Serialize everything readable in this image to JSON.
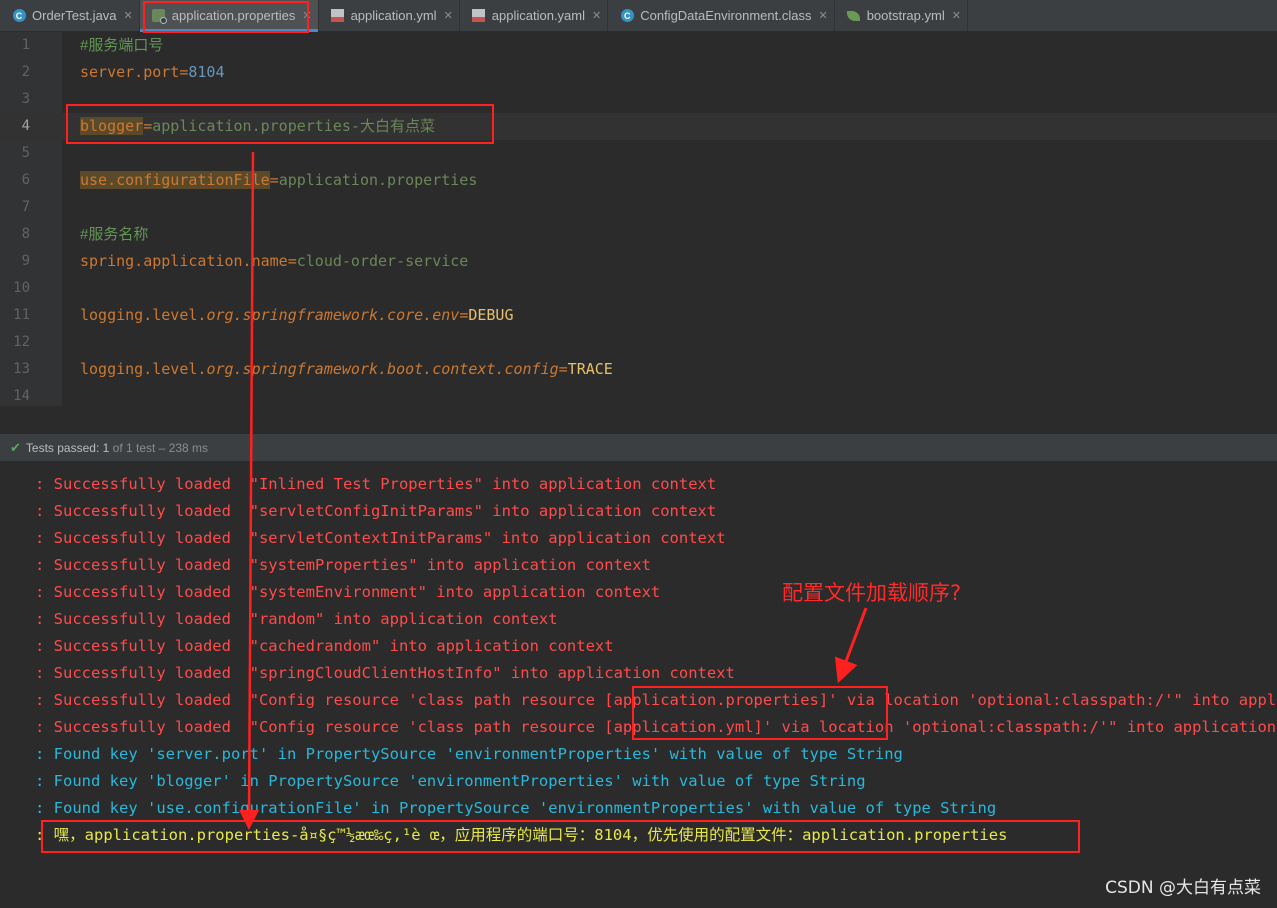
{
  "tabs": [
    {
      "label": "OrderTest.java",
      "icon": "java-class-icon"
    },
    {
      "label": "application.properties",
      "icon": "properties-file-icon",
      "active": true
    },
    {
      "label": "application.yml",
      "icon": "yml-file-icon"
    },
    {
      "label": "application.yaml",
      "icon": "yml-file-icon"
    },
    {
      "label": "ConfigDataEnvironment.class",
      "icon": "class-file-icon"
    },
    {
      "label": "bootstrap.yml",
      "icon": "spring-leaf-icon"
    }
  ],
  "editor": {
    "current_line": 4,
    "lines": [
      {
        "n": "1",
        "comment": "#服务端口号"
      },
      {
        "n": "2",
        "key": "server.port",
        "eq": "=",
        "num": "8104"
      },
      {
        "n": "3"
      },
      {
        "n": "4",
        "key": "blogger",
        "eq": "=",
        "val": "application.properties-大白有点菜"
      },
      {
        "n": "5"
      },
      {
        "n": "6",
        "key": "use.configurationFile",
        "eq": "=",
        "val": "application.properties"
      },
      {
        "n": "7"
      },
      {
        "n": "8",
        "comment": "#服务名称"
      },
      {
        "n": "9",
        "key": "spring.application.name",
        "eq": "=",
        "val": "cloud-order-service"
      },
      {
        "n": "10"
      },
      {
        "n": "11",
        "key_a": "logging.level.",
        "key_b": "org.springframework.core.env",
        "eq": "=",
        "plain": "DEBUG"
      },
      {
        "n": "12"
      },
      {
        "n": "13",
        "key_a": "logging.level.",
        "key_b": "org.springframework.boot.context.config",
        "eq": "=",
        "plain": "TRACE"
      },
      {
        "n": "14"
      }
    ]
  },
  "testbar": {
    "status": "Tests passed:",
    "passed": "1",
    "rest": "of 1 test – 238 ms"
  },
  "console": {
    "lines": [
      {
        "color": "red",
        "text": ": Successfully loaded  \"Inlined Test Properties\" into application context"
      },
      {
        "color": "red",
        "text": ": Successfully loaded  \"servletConfigInitParams\" into application context"
      },
      {
        "color": "red",
        "text": ": Successfully loaded  \"servletContextInitParams\" into application context"
      },
      {
        "color": "red",
        "text": ": Successfully loaded  \"systemProperties\" into application context"
      },
      {
        "color": "red",
        "text": ": Successfully loaded  \"systemEnvironment\" into application context"
      },
      {
        "color": "red",
        "text": ": Successfully loaded  \"random\" into application context"
      },
      {
        "color": "red",
        "text": ": Successfully loaded  \"cachedrandom\" into application context"
      },
      {
        "color": "red",
        "text": ": Successfully loaded  \"springCloudClientHostInfo\" into application context"
      },
      {
        "color": "red",
        "text": ": Successfully loaded  \"Config resource 'class path resource [application.properties]' via location 'optional:classpath:/'\" into application context"
      },
      {
        "color": "red",
        "text": ": Successfully loaded  \"Config resource 'class path resource [application.yml]' via location 'optional:classpath:/'\" into application context"
      },
      {
        "color": "cyan",
        "text": ": Found key 'server.port' in PropertySource 'environmentProperties' with value of type String"
      },
      {
        "color": "cyan",
        "text": ": Found key 'blogger' in PropertySource 'environmentProperties' with value of type String"
      },
      {
        "color": "cyan",
        "text": ": Found key 'use.configurationFile' in PropertySource 'environmentProperties' with value of type String"
      },
      {
        "color": "yellow",
        "text": ": 嘿，application.properties-å¤§ç™½æœ‰ç‚¹è œ，应用程序的端口号：8104，优先使用的配置文件：application.properties"
      }
    ]
  },
  "annotation": {
    "note": "配置文件加载顺序?",
    "watermark": "CSDN @大白有点菜"
  }
}
